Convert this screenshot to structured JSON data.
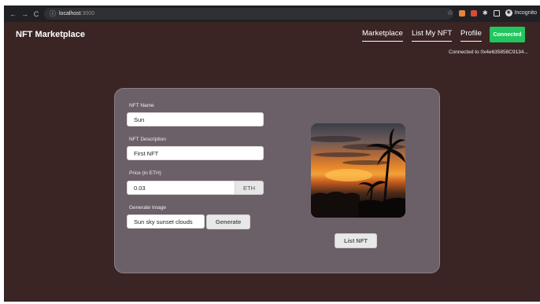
{
  "browser": {
    "url_host": "localhost",
    "url_port": ":3000",
    "incognito_label": "Incognito"
  },
  "app": {
    "brand": "NFT Marketplace",
    "nav": [
      "Marketplace",
      "List My NFT",
      "Profile"
    ],
    "connect_button": "Connected",
    "connected_text": "Connected to 0x4e635858C9134..."
  },
  "form": {
    "name_label": "NFT Name",
    "name_value": "Sun",
    "description_label": "NFT Description",
    "description_value": "First NFT",
    "price_label": "Price (in ETH)",
    "price_value": "0.03",
    "price_unit": "ETH",
    "image_label": "Generate Image",
    "image_prompt": "Sun sky sunset clouds",
    "generate_button": "Generate",
    "list_button": "List NFT"
  },
  "colors": {
    "page_background": "#3a2524",
    "card_background": "#6b5f68",
    "connected_green": "#22c55e"
  }
}
